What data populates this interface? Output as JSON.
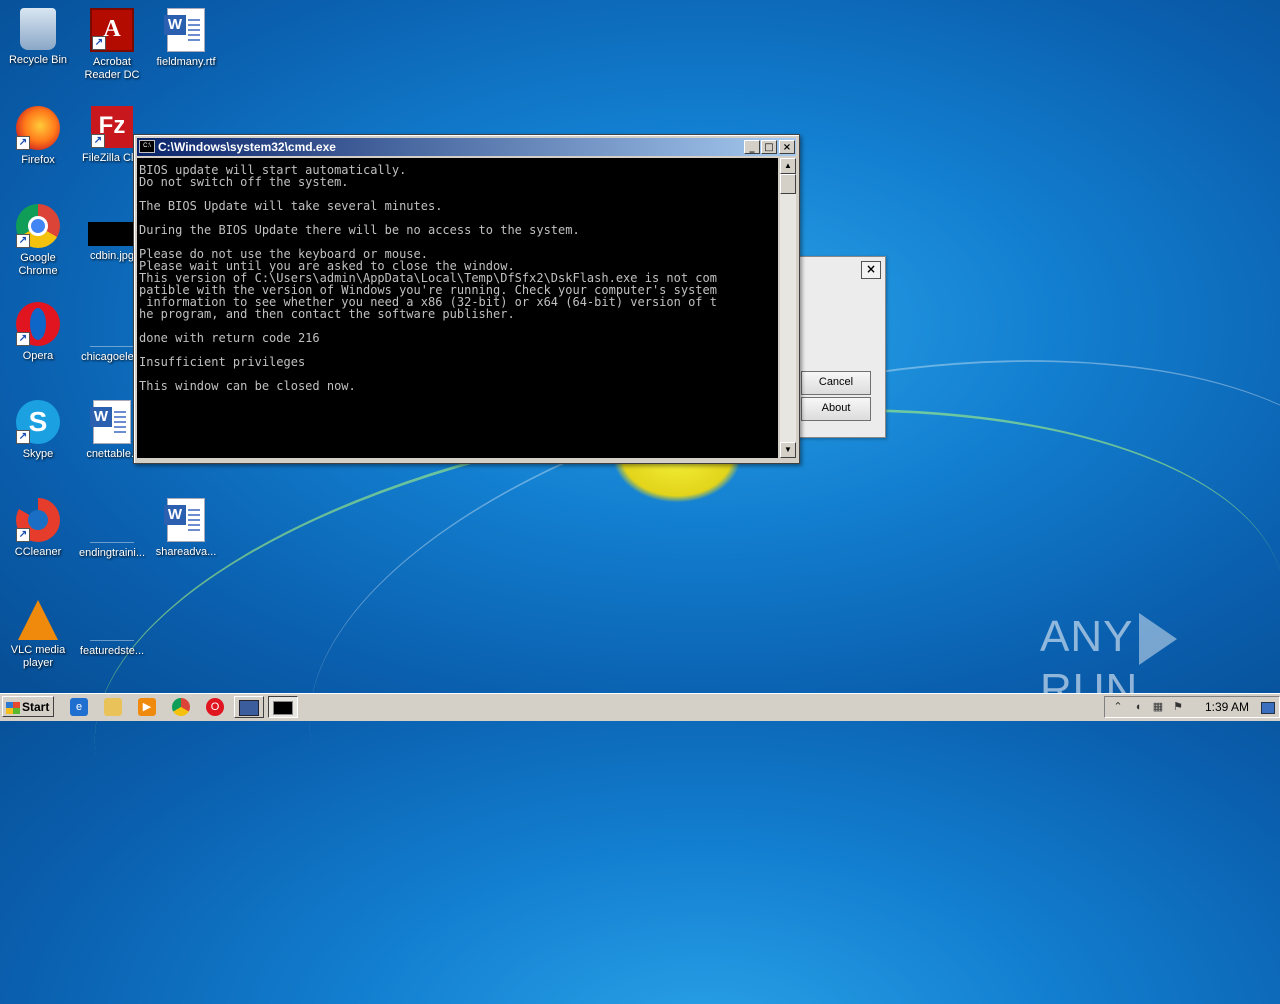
{
  "desktop": {
    "icons": [
      {
        "label": "Recycle Bin",
        "icon": "recycle-bin-icon"
      },
      {
        "label": "Acrobat Reader DC",
        "icon": "acrobat-icon"
      },
      {
        "label": "fieldmany.rtf",
        "icon": "word-document-icon"
      },
      {
        "label": "Firefox",
        "icon": "firefox-icon"
      },
      {
        "label": "FileZilla Clie",
        "icon": "filezilla-icon"
      },
      {
        "label": "Google Chrome",
        "icon": "chrome-icon"
      },
      {
        "label": "cdbin.jpg",
        "icon": "image-file-icon"
      },
      {
        "label": "Opera",
        "icon": "opera-icon"
      },
      {
        "label": "chicagoelem",
        "icon": "file-icon"
      },
      {
        "label": "Skype",
        "icon": "skype-icon"
      },
      {
        "label": "cnettable.r",
        "icon": "word-document-icon"
      },
      {
        "label": "CCleaner",
        "icon": "ccleaner-icon"
      },
      {
        "label": "endingtraini...",
        "icon": "file-icon"
      },
      {
        "label": "shareadva...",
        "icon": "word-document-icon"
      },
      {
        "label": "VLC media player",
        "icon": "vlc-icon"
      },
      {
        "label": "featuredste...",
        "icon": "file-icon"
      }
    ]
  },
  "cmd_window": {
    "title": "C:\\Windows\\system32\\cmd.exe",
    "title_icon_text": "C:\\",
    "minimize": "_",
    "maximize": "□",
    "close": "×",
    "output": "BIOS update will start automatically.\nDo not switch off the system.\n\nThe BIOS Update will take several minutes.\n\nDuring the BIOS Update there will be no access to the system.\n\nPlease do not use the keyboard or mouse.\nPlease wait until you are asked to close the window.\nThis version of C:\\Users\\admin\\AppData\\Local\\Temp\\DfSfx2\\DskFlash.exe is not com\npatible with the version of Windows you're running. Check your computer's system\n information to see whether you need a x86 (32-bit) or x64 (64-bit) version of t\nhe program, and then contact the software publisher.\n\ndone with return code 216\n\nInsufficient privileges\n\nThis window can be closed now.",
    "scroll_up": "▲",
    "scroll_down": "▼"
  },
  "background_dialog": {
    "close": "×",
    "cancel_label": "Cancel",
    "about_label": "About"
  },
  "taskbar": {
    "start_label": "Start",
    "clock": "1:39 AM",
    "tray_expand": "⌃"
  },
  "watermark": {
    "left": "ANY",
    "right": "RUN"
  },
  "colors": {
    "title_bar_start": "#0a246a",
    "title_bar_end": "#a6caf0",
    "console_bg": "#000000",
    "console_text": "#c0c0c0"
  }
}
